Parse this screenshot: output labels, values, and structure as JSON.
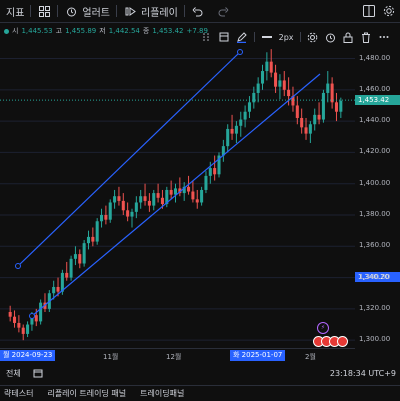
{
  "toolbar": {
    "indicators_label": "지표",
    "alert_label": "얼러트",
    "replay_label": "리플레이"
  },
  "legend": {
    "o_key": "시",
    "o_val": "1,445.53",
    "h_key": "고",
    "h_val": "1,455.89",
    "l_key": "저",
    "l_val": "1,442.54",
    "c_key": "종",
    "c_val": "1,453.42",
    "chg": "+7.89"
  },
  "draw_toolbar": {
    "width_label": "2px"
  },
  "price_axis": {
    "labels": [
      "1,480.00",
      "1,460.00",
      "1,440.00",
      "1,420.00",
      "1,400.00",
      "1,380.00",
      "1,360.00",
      "1,340.00",
      "1,320.00",
      "1,300.00"
    ],
    "current_price": "1,453.42",
    "channel_price": "1,340.20"
  },
  "time_axis": {
    "tag_left": "월 2024-09-23",
    "label_nov": "11월",
    "label_dec": "12월",
    "tag_mid": "화 2025-01-07",
    "label_feb": "2월"
  },
  "status": {
    "all_label": "전체",
    "time": "23:18:34 UTC+9"
  },
  "bottom_tabs": {
    "tab1": "략테스터",
    "tab2": "리플레이 트레이딩 패널",
    "tab3": "트레이딩패널"
  },
  "colors": {
    "up": "#26a69a",
    "down": "#ef5350",
    "channel": "#2962ff",
    "accent": "#2962ff"
  },
  "chart_data": {
    "type": "candlestick",
    "ylim": [
      1295,
      1488
    ],
    "candles": [
      [
        1318,
        1322,
        1312,
        1315
      ],
      [
        1315,
        1319,
        1308,
        1311
      ],
      [
        1311,
        1316,
        1305,
        1308
      ],
      [
        1308,
        1310,
        1300,
        1304
      ],
      [
        1304,
        1312,
        1302,
        1310
      ],
      [
        1310,
        1318,
        1306,
        1316
      ],
      [
        1316,
        1320,
        1309,
        1312
      ],
      [
        1312,
        1326,
        1310,
        1324
      ],
      [
        1324,
        1330,
        1318,
        1320
      ],
      [
        1320,
        1332,
        1318,
        1330
      ],
      [
        1330,
        1338,
        1326,
        1334
      ],
      [
        1334,
        1340,
        1328,
        1331
      ],
      [
        1331,
        1345,
        1329,
        1343
      ],
      [
        1343,
        1350,
        1338,
        1340
      ],
      [
        1340,
        1354,
        1338,
        1352
      ],
      [
        1352,
        1360,
        1348,
        1355
      ],
      [
        1355,
        1358,
        1346,
        1349
      ],
      [
        1349,
        1364,
        1347,
        1362
      ],
      [
        1362,
        1370,
        1358,
        1366
      ],
      [
        1366,
        1372,
        1360,
        1363
      ],
      [
        1363,
        1378,
        1361,
        1376
      ],
      [
        1376,
        1384,
        1372,
        1380
      ],
      [
        1380,
        1386,
        1374,
        1377
      ],
      [
        1377,
        1390,
        1375,
        1388
      ],
      [
        1388,
        1396,
        1384,
        1392
      ],
      [
        1392,
        1398,
        1386,
        1389
      ],
      [
        1389,
        1394,
        1380,
        1383
      ],
      [
        1383,
        1388,
        1376,
        1379
      ],
      [
        1379,
        1384,
        1372,
        1382
      ],
      [
        1382,
        1392,
        1378,
        1388
      ],
      [
        1388,
        1396,
        1384,
        1392
      ],
      [
        1392,
        1400,
        1386,
        1389
      ],
      [
        1389,
        1394,
        1382,
        1386
      ],
      [
        1386,
        1396,
        1383,
        1394
      ],
      [
        1394,
        1400,
        1388,
        1391
      ],
      [
        1391,
        1396,
        1384,
        1387
      ],
      [
        1387,
        1398,
        1385,
        1396
      ],
      [
        1396,
        1402,
        1390,
        1393
      ],
      [
        1393,
        1400,
        1388,
        1397
      ],
      [
        1397,
        1404,
        1392,
        1394
      ],
      [
        1394,
        1401,
        1389,
        1398
      ],
      [
        1398,
        1405,
        1393,
        1395
      ],
      [
        1395,
        1402,
        1388,
        1390
      ],
      [
        1390,
        1396,
        1384,
        1388
      ],
      [
        1388,
        1398,
        1386,
        1396
      ],
      [
        1396,
        1408,
        1394,
        1405
      ],
      [
        1405,
        1414,
        1400,
        1410
      ],
      [
        1410,
        1418,
        1402,
        1406
      ],
      [
        1406,
        1420,
        1404,
        1418
      ],
      [
        1418,
        1428,
        1414,
        1424
      ],
      [
        1424,
        1438,
        1420,
        1435
      ],
      [
        1435,
        1444,
        1428,
        1432
      ],
      [
        1432,
        1440,
        1426,
        1437
      ],
      [
        1437,
        1446,
        1430,
        1441
      ],
      [
        1441,
        1450,
        1436,
        1446
      ],
      [
        1446,
        1456,
        1442,
        1452
      ],
      [
        1452,
        1462,
        1448,
        1458
      ],
      [
        1458,
        1468,
        1452,
        1464
      ],
      [
        1464,
        1476,
        1460,
        1472
      ],
      [
        1472,
        1484,
        1466,
        1478
      ],
      [
        1478,
        1486,
        1468,
        1471
      ],
      [
        1471,
        1476,
        1458,
        1462
      ],
      [
        1462,
        1470,
        1454,
        1466
      ],
      [
        1466,
        1472,
        1456,
        1460
      ],
      [
        1460,
        1468,
        1450,
        1456
      ],
      [
        1456,
        1462,
        1446,
        1450
      ],
      [
        1450,
        1456,
        1438,
        1442
      ],
      [
        1442,
        1448,
        1432,
        1436
      ],
      [
        1436,
        1442,
        1428,
        1432
      ],
      [
        1432,
        1440,
        1426,
        1438
      ],
      [
        1438,
        1448,
        1434,
        1444
      ],
      [
        1444,
        1452,
        1438,
        1441
      ],
      [
        1441,
        1460,
        1439,
        1458
      ],
      [
        1458,
        1472,
        1452,
        1464
      ],
      [
        1464,
        1468,
        1448,
        1452
      ],
      [
        1452,
        1458,
        1440,
        1446
      ],
      [
        1446,
        1455,
        1442,
        1453
      ]
    ]
  }
}
